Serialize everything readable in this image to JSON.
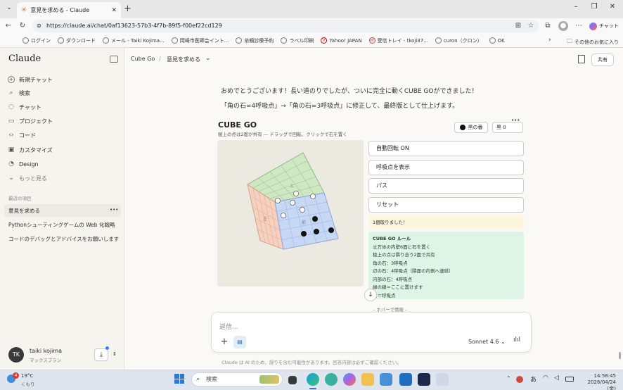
{
  "browser": {
    "tab_title": "意見を求める - Claude",
    "url": "https://claude.ai/chat/0af13623-57b3-4f7b-89f5-f00ef22cd129",
    "new_tab": "+",
    "profile_button": "チャット",
    "bookmarks": [
      "ログイン",
      "ダウンロード",
      "メール - Taiki Kojima...",
      "岡崎市医師会イント...",
      "依頼診療予約",
      "ラベル印刷",
      "Yahoo! JAPAN",
      "受信トレイ - tkoji37...",
      "curon（クロン）",
      "OK"
    ],
    "other_bookmarks": "その他のお気に入り"
  },
  "sidebar": {
    "logo": "Claude",
    "items": [
      {
        "label": "新規チャット",
        "icon": "plus-icon"
      },
      {
        "label": "検索",
        "icon": "search-icon"
      },
      {
        "label": "チャット",
        "icon": "chat-icon"
      },
      {
        "label": "プロジェクト",
        "icon": "folder-icon"
      },
      {
        "label": "コード",
        "icon": "code-icon"
      },
      {
        "label": "カスタマイズ",
        "icon": "briefcase-icon"
      },
      {
        "label": "Design",
        "icon": "palette-icon"
      },
      {
        "label": "もっと見る",
        "icon": "chevron-down-icon"
      }
    ],
    "recent_header": "最近の項目",
    "recents": [
      "意見を求める",
      "Pythonシューティングゲームの Web 化戦略",
      "コードのデバッグとアドバイスをお願いします"
    ],
    "recent_more": "•••",
    "user": {
      "initials": "TK",
      "name": "taiki kojima",
      "plan": "マックスプラン"
    }
  },
  "header": {
    "project": "Cube Go",
    "separator": "/",
    "chat_title": "意見を求める",
    "share": "共有"
  },
  "message": {
    "line1": "おめでとうございます！長い道のりでしたが、ついに完全に動くCUBE GOができました！",
    "line2": "「角の石=4呼吸点」→「角の石=3呼吸点」に修正して、最終版として仕上げます。"
  },
  "game": {
    "title": "CUBE GO",
    "subtitle": "稜上の点は2面が共有 — ドラッグで回転、クリックで石を置く",
    "turn": "黒の番",
    "score": "黒 0",
    "more": "•••",
    "face_labels": [
      "上",
      "前",
      "左"
    ],
    "buttons": [
      "自動回転 ON",
      "呼吸点を表示",
      "パス",
      "リセット"
    ],
    "status": "1個取りました！",
    "rules": [
      "CUBE GO ルール",
      "立方体の内壁6面に石を置く",
      "稜上の点は隣り合う2面で共有",
      "角の石：3呼吸点",
      "辺の石：4呼吸点（隣面の内側へ連結）",
      "内部の石：4呼吸点",
      "緑の線＝ここに置けます",
      "点＝呼吸点"
    ],
    "hover_info": "– ホバーで情報 –",
    "stones_black": 4,
    "stones_white": 8
  },
  "composer": {
    "placeholder": "返信...",
    "model": "Sonnet 4.6",
    "disclaimer": "Claude は AI のため、誤りを含む可能性があります。回答内容は必ずご確認ください。"
  },
  "taskbar": {
    "temp": "19°C",
    "weather": "くもり",
    "weather_badge": "4",
    "search": "検索",
    "time": "14:58:45",
    "date": "2026/04/24 (金)",
    "ime": "あ"
  },
  "colors": {
    "accent": "#d97757",
    "face_top": "#cfe8c4",
    "face_left": "#f6d1bf",
    "face_right": "#c7d8f4",
    "rules_bg": "#def4e7"
  }
}
